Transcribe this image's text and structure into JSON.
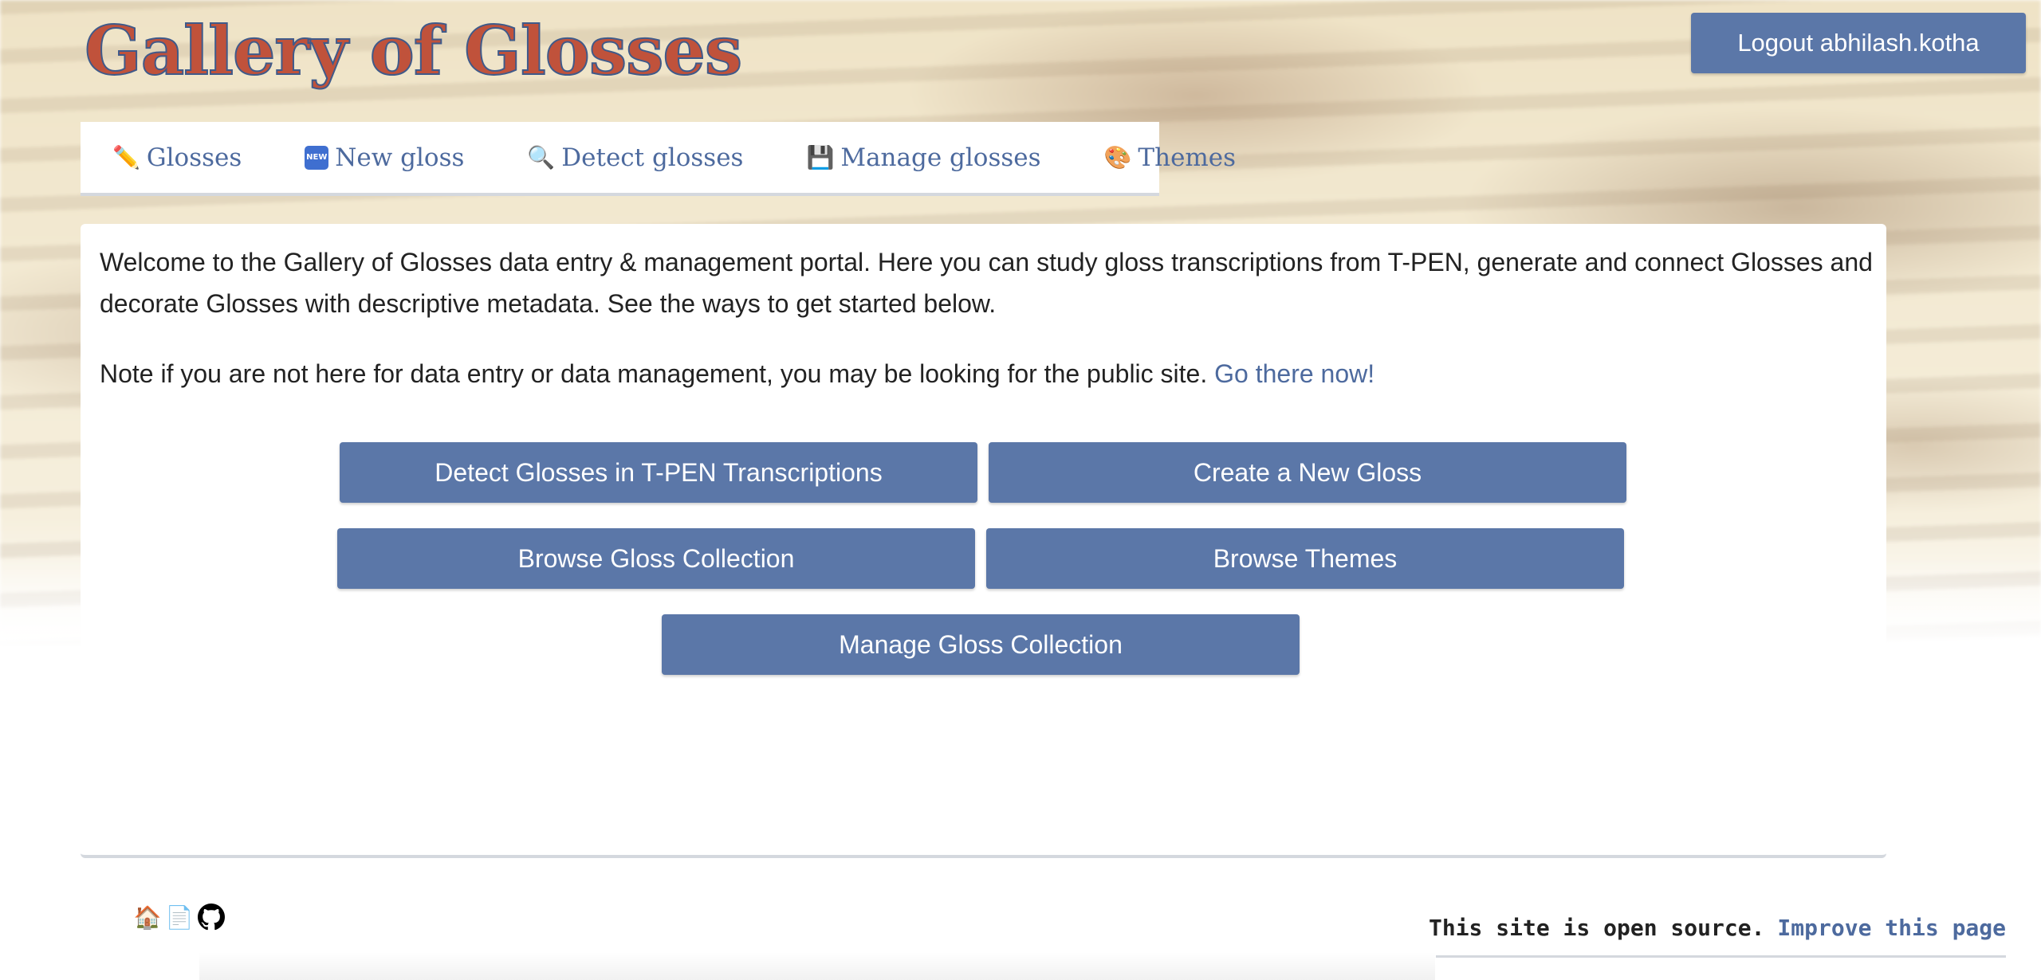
{
  "header": {
    "site_title": "Gallery of Glosses",
    "logout_label": "Logout abhilash.kotha"
  },
  "nav": {
    "tabs": [
      {
        "icon": "pencil-icon",
        "glyph": "✏️",
        "label": "Glosses"
      },
      {
        "icon": "new-badge-icon",
        "glyph": "NEW",
        "label": "New gloss"
      },
      {
        "icon": "magnifier-icon",
        "glyph": "🔍",
        "label": "Detect glosses"
      },
      {
        "icon": "floppy-disk-icon",
        "glyph": "💾",
        "label": "Manage glosses"
      },
      {
        "icon": "palette-icon",
        "glyph": "🎨",
        "label": "Themes"
      }
    ]
  },
  "main": {
    "intro": "Welcome to the Gallery of Glosses data entry & management portal. Here you can study gloss transcriptions from T-PEN, generate and connect Glosses and decorate Glosses with descriptive metadata. See the ways to get started below.",
    "note_text": "Note if you are not here for data entry or data management, you may be looking for the public site.",
    "note_link": "Go there now!",
    "actions": {
      "detect": "Detect Glosses in T-PEN Transcriptions",
      "create": "Create a New Gloss",
      "browse": "Browse Gloss Collection",
      "themes": "Browse Themes",
      "manage": "Manage Gloss Collection"
    }
  },
  "footer": {
    "icons": [
      {
        "icon": "home-icon",
        "glyph": "🏠"
      },
      {
        "icon": "document-icon",
        "glyph": "📄"
      },
      {
        "icon": "github-icon",
        "glyph": ""
      }
    ],
    "oss_text": "This site is open source.",
    "oss_link": "Improve this page"
  },
  "colors": {
    "accent": "#5b77a8",
    "link": "#4d6a9e",
    "title_fill": "#c0523b",
    "title_stroke": "#3f5a8a"
  }
}
